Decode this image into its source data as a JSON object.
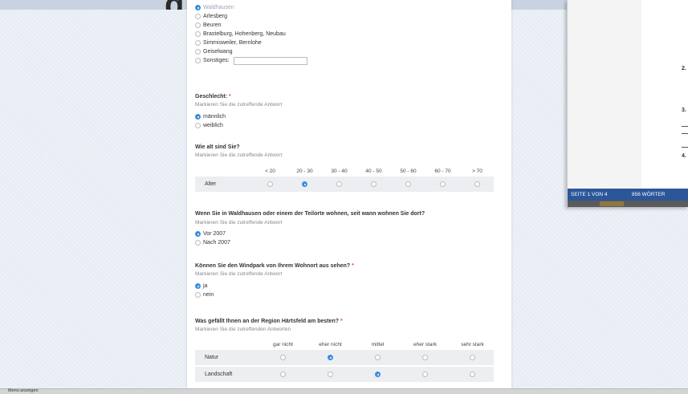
{
  "residence": {
    "options": [
      {
        "label": "Waldhausen",
        "selected": true
      },
      {
        "label": "Arlesberg",
        "selected": false
      },
      {
        "label": "Beuren",
        "selected": false
      },
      {
        "label": "Brastelburg, Hohenberg, Neubau",
        "selected": false
      },
      {
        "label": "Simmisweiler, Bernlohe",
        "selected": false
      },
      {
        "label": "Geiselwang",
        "selected": false
      },
      {
        "label": "Sonstiges:",
        "selected": false
      }
    ],
    "other_value": ""
  },
  "gender": {
    "title": "Geschlecht:",
    "required_mark": "*",
    "hint": "Markieren Sie die zutreffende Antwort",
    "options": [
      {
        "label": "männlich",
        "selected": true
      },
      {
        "label": "weiblich",
        "selected": false
      }
    ]
  },
  "age": {
    "title": "Wie alt sind Sie?",
    "hint": "Markieren Sie die zutreffende Antwort",
    "columns": [
      "< 20",
      "20 - 30",
      "30 - 40",
      "40 - 50",
      "50 - 60",
      "60 - 70",
      "> 70"
    ],
    "row_label": "Alter",
    "selected_index": 1
  },
  "residence_since": {
    "title": "Wenn Sie in Waldhausen oder einem der Teilorte wohnen, seit wann wohnen Sie dort?",
    "hint": "Markieren Sie die zutreffende Antwort",
    "options": [
      {
        "label": "Vor 2007",
        "selected": true
      },
      {
        "label": "Nach 2007",
        "selected": false
      }
    ]
  },
  "windpark_visible": {
    "title": "Können Sie den Windpark von Ihrem Wohnort aus sehen?",
    "required_mark": "*",
    "hint": "Markieren Sie die zutreffende Antwort",
    "options": [
      {
        "label": "ja",
        "selected": true
      },
      {
        "label": "nein",
        "selected": false
      }
    ]
  },
  "region_likes": {
    "title": "Was gefällt Ihnen an der Region Härtsfeld am besten?",
    "required_mark": "*",
    "hint": "Markieren Sie die zutreffenden Antworten",
    "columns": [
      "gar nicht",
      "eher nicht",
      "mittel",
      "eher stark",
      "sehr stark"
    ],
    "rows": [
      {
        "label": "Natur",
        "selected_index": 1
      },
      {
        "label": "Landschaft",
        "selected_index": 2
      }
    ]
  },
  "word_window": {
    "page_count": "SEITE 1 VON 4",
    "word_count": "856 WÖRTER",
    "heading_numbers": [
      "2.",
      "3.",
      "4."
    ],
    "status_color": "#2b579a"
  },
  "status_bar": {
    "menu_label": "Menü anzeigen"
  },
  "colors": {
    "accent": "#3b8de0",
    "required": "#d9534f"
  }
}
